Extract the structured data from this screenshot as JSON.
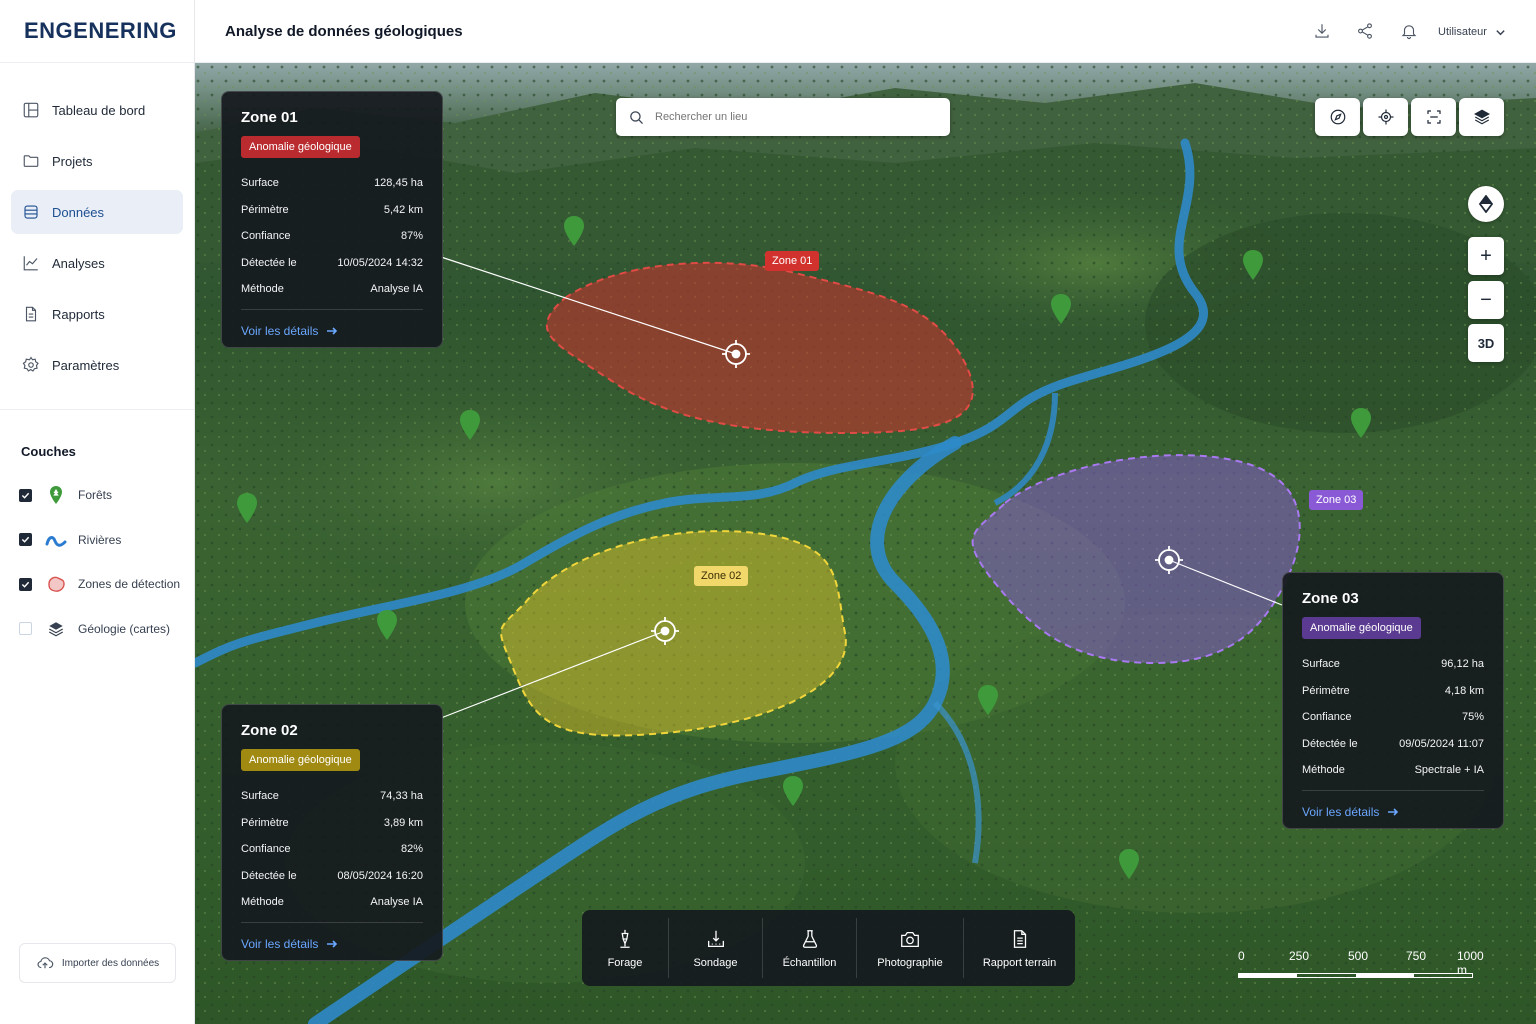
{
  "brand": "ENGENERING",
  "header": {
    "title": "Analyse de données géologiques",
    "user_label": "Utilisateur",
    "icons": [
      "download-icon",
      "share-icon",
      "bell-icon",
      "chevron-down-icon"
    ]
  },
  "sidebar": {
    "items": [
      {
        "label": "Tableau de bord",
        "icon": "dashboard-icon",
        "active": false
      },
      {
        "label": "Projets",
        "icon": "folder-icon",
        "active": false
      },
      {
        "label": "Données",
        "icon": "database-icon",
        "active": true
      },
      {
        "label": "Analyses",
        "icon": "chart-line-icon",
        "active": false
      },
      {
        "label": "Rapports",
        "icon": "document-icon",
        "active": false
      },
      {
        "label": "Paramètres",
        "icon": "gear-icon",
        "active": false
      }
    ],
    "layers_title": "Couches",
    "layers": [
      {
        "label": "Forêts",
        "checked": true,
        "icon": "forest-pin-icon"
      },
      {
        "label": "Rivières",
        "checked": true,
        "icon": "river-icon"
      },
      {
        "label": "Zones de détection",
        "checked": true,
        "icon": "detection-zone-icon"
      },
      {
        "label": "Géologie (cartes)",
        "checked": false,
        "icon": "layers-icon"
      }
    ],
    "import_label": "Importer des données"
  },
  "map": {
    "search_placeholder": "Rechercher un lieu",
    "tools_top": [
      "compass-needle-icon",
      "locate-icon",
      "scan-icon",
      "layers-icon"
    ],
    "zoom_in": "+",
    "zoom_out": "−",
    "view_3d": "3D",
    "zone_labels": {
      "z1": "Zone 01",
      "z2": "Zone 02",
      "z3": "Zone 03"
    },
    "colors": {
      "zone1": "#d2322d",
      "zone2": "#e6c52a",
      "zone3": "#8a5ad6",
      "link": "#6aa7ff"
    },
    "panels": {
      "z1": {
        "title": "Zone 01",
        "badge": "Anomalie géologique",
        "rows": [
          [
            "Surface",
            "128,45 ha"
          ],
          [
            "Périmètre",
            "5,42 km"
          ],
          [
            "Confiance",
            "87%"
          ],
          [
            "Détectée le",
            "10/05/2024 14:32"
          ],
          [
            "Méthode",
            "Analyse IA"
          ]
        ],
        "details": "Voir les détails"
      },
      "z2": {
        "title": "Zone 02",
        "badge": "Anomalie géologique",
        "rows": [
          [
            "Surface",
            "74,33 ha"
          ],
          [
            "Périmètre",
            "3,89 km"
          ],
          [
            "Confiance",
            "82%"
          ],
          [
            "Détectée le",
            "08/05/2024 16:20"
          ],
          [
            "Méthode",
            "Analyse IA"
          ]
        ],
        "details": "Voir les détails"
      },
      "z3": {
        "title": "Zone 03",
        "badge": "Anomalie géologique",
        "rows": [
          [
            "Surface",
            "96,12 ha"
          ],
          [
            "Périmètre",
            "4,18 km"
          ],
          [
            "Confiance",
            "75%"
          ],
          [
            "Détectée le",
            "09/05/2024 11:07"
          ],
          [
            "Méthode",
            "Spectrale + IA"
          ]
        ],
        "details": "Voir les détails"
      }
    },
    "bottom_tools": [
      {
        "label": "Forage",
        "icon": "drill-icon"
      },
      {
        "label": "Sondage",
        "icon": "probe-icon"
      },
      {
        "label": "Échantillon",
        "icon": "flask-icon"
      },
      {
        "label": "Photographie",
        "icon": "camera-icon"
      },
      {
        "label": "Rapport terrain",
        "icon": "report-icon"
      }
    ],
    "scale": {
      "labels": [
        "0",
        "250",
        "500",
        "750",
        "1000 m"
      ]
    }
  }
}
